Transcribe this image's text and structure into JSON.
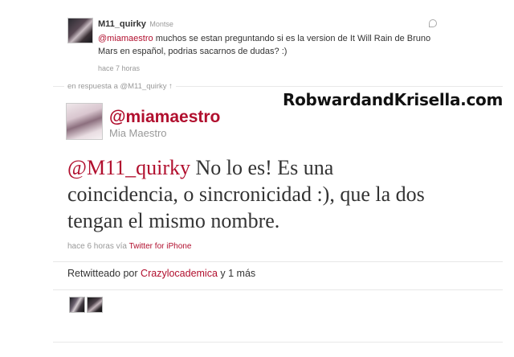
{
  "original_tweet": {
    "username": "M11_quirky",
    "full_name": "Montse",
    "mention": "@miamaestro",
    "text": " muchos se estan preguntando si es la version de It Will Rain de Bruno Mars en español, podrias sacarnos de dudas? :)",
    "time": "hace 7 horas"
  },
  "reply_context": {
    "label": "en respuesta a @M11_quirky ↑"
  },
  "watermark": "RobwardandKrisella.com",
  "main_tweet": {
    "username": "@miamaestro",
    "full_name": "Mia Maestro",
    "mention": "@M11_quirky",
    "text": " No lo es! Es una coincidencia, o sincronicidad :), que la dos tengan el mismo nombre.",
    "time": "hace 6 horas",
    "via_label": "vía",
    "client": "Twitter for iPhone"
  },
  "retweet": {
    "label": "Retwitteado por",
    "user": "Crazylocademica",
    "more": "y 1 más"
  },
  "colors": {
    "link": "#b10f2e",
    "muted": "#999999",
    "text": "#333333"
  },
  "icons": [
    "reply-icon"
  ]
}
